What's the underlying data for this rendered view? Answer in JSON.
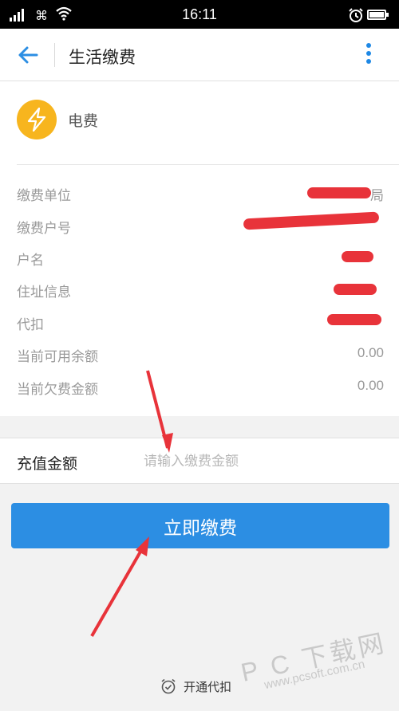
{
  "status_bar": {
    "time": "16:11",
    "carrier_glyph": "⌘"
  },
  "header": {
    "title": "生活缴费"
  },
  "biller": {
    "name": "电费",
    "icon": "lightning-bolt-icon",
    "color": "#f7b51e"
  },
  "details": [
    {
      "label": "缴费单位",
      "value": "局"
    },
    {
      "label": "缴费户号",
      "value": ""
    },
    {
      "label": "户名",
      "value": ""
    },
    {
      "label": "住址信息",
      "value": ""
    },
    {
      "label": "代扣",
      "value": ""
    },
    {
      "label": "当前可用余额",
      "value": "0.00"
    },
    {
      "label": "当前欠费金额",
      "value": "0.00"
    }
  ],
  "amount": {
    "label": "充值金额",
    "placeholder": "请输入缴费金额"
  },
  "pay_button": {
    "label": "立即缴费"
  },
  "autopay": {
    "label": "开通代扣"
  },
  "watermark": {
    "text": "P C 下载网",
    "url": "www.pcsoft.com.cn"
  },
  "colors": {
    "accent": "#2c8ee3",
    "redaction": "#e8333a",
    "annotation_arrow": "#e8333a"
  }
}
